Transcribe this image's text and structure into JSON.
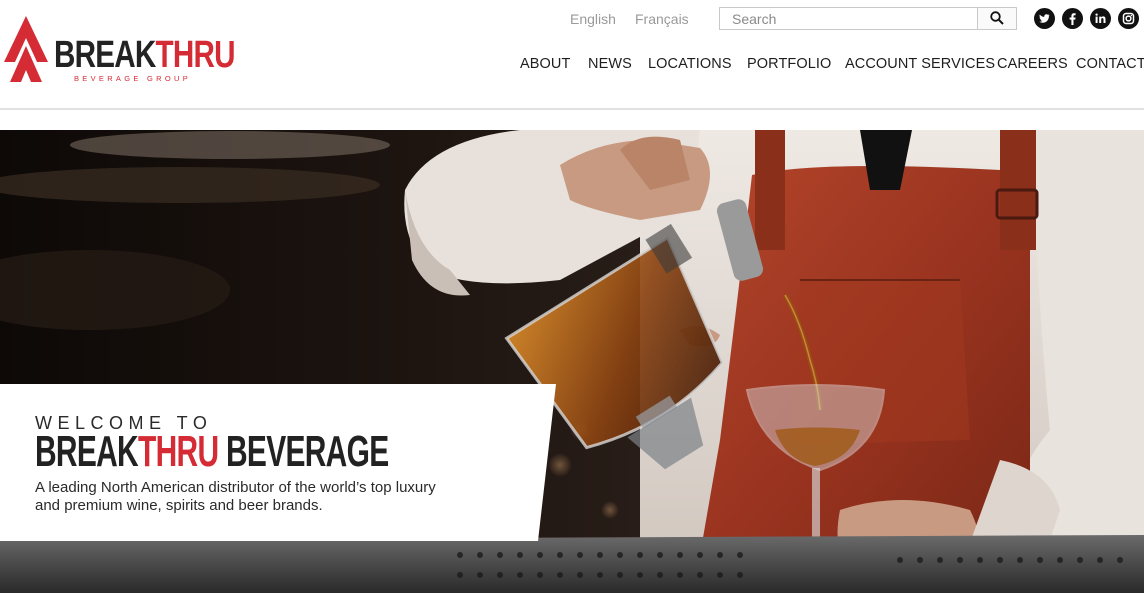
{
  "brand": {
    "name_part1": "BREAK",
    "name_part2": "THRU",
    "subtitle": "BEVERAGE GROUP",
    "red": "#d52b35"
  },
  "languages": [
    "English",
    "Français"
  ],
  "search": {
    "placeholder": "Search",
    "icon": "search-icon"
  },
  "social": [
    {
      "icon": "twitter-icon"
    },
    {
      "icon": "facebook-icon"
    },
    {
      "icon": "linkedin-icon"
    },
    {
      "icon": "instagram-icon"
    }
  ],
  "nav": {
    "items": [
      "ABOUT",
      "NEWS",
      "LOCATIONS",
      "PORTFOLIO",
      "ACCOUNT SERVICES",
      "CAREERS",
      "CONTACT"
    ]
  },
  "hero": {
    "kicker": "WELCOME TO",
    "headline_part1": "BREAK",
    "headline_part2": "THRU",
    "headline_part3": " BEVERAGE",
    "body": "A leading North American distributor of the world’s top luxury and premium wine, spirits and beer brands."
  }
}
